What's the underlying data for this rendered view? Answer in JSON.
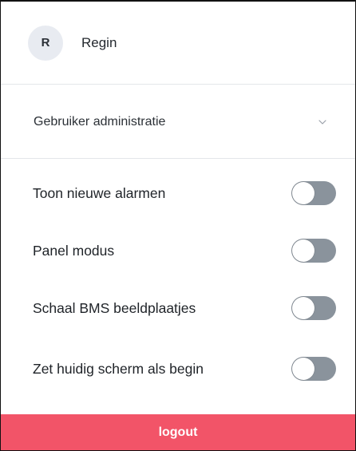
{
  "user": {
    "initial": "R",
    "name": "Regin"
  },
  "admin_menu": {
    "label": "Gebruiker administratie",
    "icon": "chevron-down-icon"
  },
  "settings": [
    {
      "label": "Toon nieuwe alarmen",
      "enabled": false
    },
    {
      "label": "Panel modus",
      "enabled": false
    },
    {
      "label": "Schaal BMS beeldplaatjes",
      "enabled": false
    },
    {
      "label": "Zet huidig scherm als begin",
      "enabled": false
    }
  ],
  "logout": {
    "label": "logout"
  },
  "colors": {
    "logout_bg": "#f25468",
    "toggle_off": "#8a939c",
    "avatar_bg": "#e8ebf1"
  }
}
